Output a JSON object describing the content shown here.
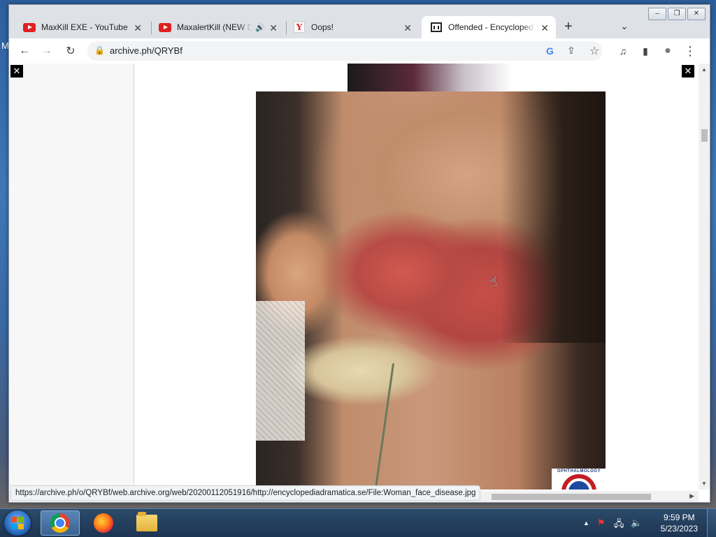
{
  "window": {
    "controls": [
      "–",
      "❐",
      "✕"
    ]
  },
  "tabs": [
    {
      "title": "MaxKill EXE - YouTube",
      "icon": "youtube-icon"
    },
    {
      "title": "MaxalertKill (NEW D",
      "icon": "youtube-icon",
      "audio": "🔊"
    },
    {
      "title": "Oops!",
      "icon": "yandex-icon",
      "icon_letter": "Y"
    },
    {
      "title": "Offended - Encycloped",
      "icon": "archive-icon",
      "active": true
    }
  ],
  "tab_close_glyph": "✕",
  "new_tab_glyph": "+",
  "tab_search_glyph": "⌄",
  "toolbar": {
    "back_glyph": "←",
    "forward_glyph": "→",
    "reload_glyph": "↻",
    "url": "archive.ph/QRYBf",
    "lock_glyph": "🔒",
    "google_letter": "G",
    "share_glyph": "⇪",
    "star_glyph": "☆",
    "media_glyph": "♫",
    "sidepanel_glyph": "▮",
    "profile_glyph": "●",
    "menu_glyph": "⋮"
  },
  "page": {
    "close_glyph": "✕",
    "logo_label": "OPHTHALMOLOGY"
  },
  "status": {
    "link": "https://archive.ph/o/QRYBf/web.archive.org/web/20200112051916/http://encyclopediadramatica.se/File:Woman_face_disease.jpg"
  },
  "desktop": {
    "edge_text": "M"
  },
  "taskbar": {
    "apps": [
      "chrome",
      "firefox",
      "file-explorer"
    ],
    "tray_glyphs": [
      "▲",
      "⚑",
      "🖧",
      "🔈"
    ],
    "time": "9:59 PM",
    "date": "5/23/2023"
  },
  "colors": {
    "tab_bar": "#dee1e6",
    "active_tab": "#ffffff",
    "youtube_red": "#e02020",
    "taskbar": "#1d3552"
  }
}
